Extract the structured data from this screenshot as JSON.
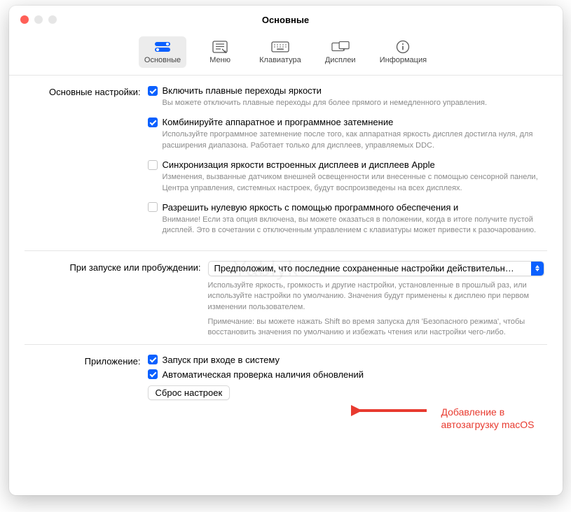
{
  "window": {
    "title": "Основные"
  },
  "toolbar": {
    "items": [
      {
        "label": "Основные"
      },
      {
        "label": "Меню"
      },
      {
        "label": "Клавиатура"
      },
      {
        "label": "Дисплеи"
      },
      {
        "label": "Информация"
      }
    ]
  },
  "sections": {
    "general": {
      "label": "Основные настройки:",
      "opts": [
        {
          "checked": true,
          "label": "Включить плавные переходы яркости",
          "desc": "Вы можете отключить плавные переходы для более прямого и немедленного управления."
        },
        {
          "checked": true,
          "label": "Комбинируйте аппаратное и программное затемнение",
          "desc": "Используйте программное затемнение после того, как аппаратная яркость дисплея достигла нуля, для расширения диапазона. Работает только для дисплеев, управляемых DDC."
        },
        {
          "checked": false,
          "label": "Синхронизация яркости встроенных дисплеев и дисплеев Apple",
          "desc": "Изменения, вызванные датчиком внешней освещенности или внесенные с помощью сенсорной панели, Центра управления, системных настроек, будут воспроизведены на всех дисплеях."
        },
        {
          "checked": false,
          "label": "Разрешить нулевую яркость с помощью программного обеспечения и",
          "desc": "Внимание! Если эта опция включена, вы можете оказаться в положении, когда в итоге получите пустой дисплей. Это в сочетании с отключенным управлением с клавиатуры может привести к разочарованию."
        }
      ]
    },
    "startup": {
      "label": "При запуске или пробуждении:",
      "select_value": "Предположим, что последние сохраненные настройки действительн…",
      "desc1": "Используйте яркость, громкость и другие настройки, установленные в прошлый раз, или используйте настройки по умолчанию. Значения будут применены к дисплею при первом изменении пользователем.",
      "desc2": "Примечание: вы можете нажать Shift во время запуска для 'Безопасного режима', чтобы восстановить значения по умолчанию и избежать чтения или настройки чего-либо."
    },
    "app": {
      "label": "Приложение:",
      "opts": [
        {
          "checked": true,
          "label": "Запуск при входе в систему"
        },
        {
          "checked": true,
          "label": "Автоматическая проверка наличия обновлений"
        }
      ],
      "reset_button": "Сброс настроек"
    }
  },
  "annotation": {
    "line1": "Добавление в",
    "line2": "автозагрузку macOS"
  },
  "watermark": "Yablyk"
}
